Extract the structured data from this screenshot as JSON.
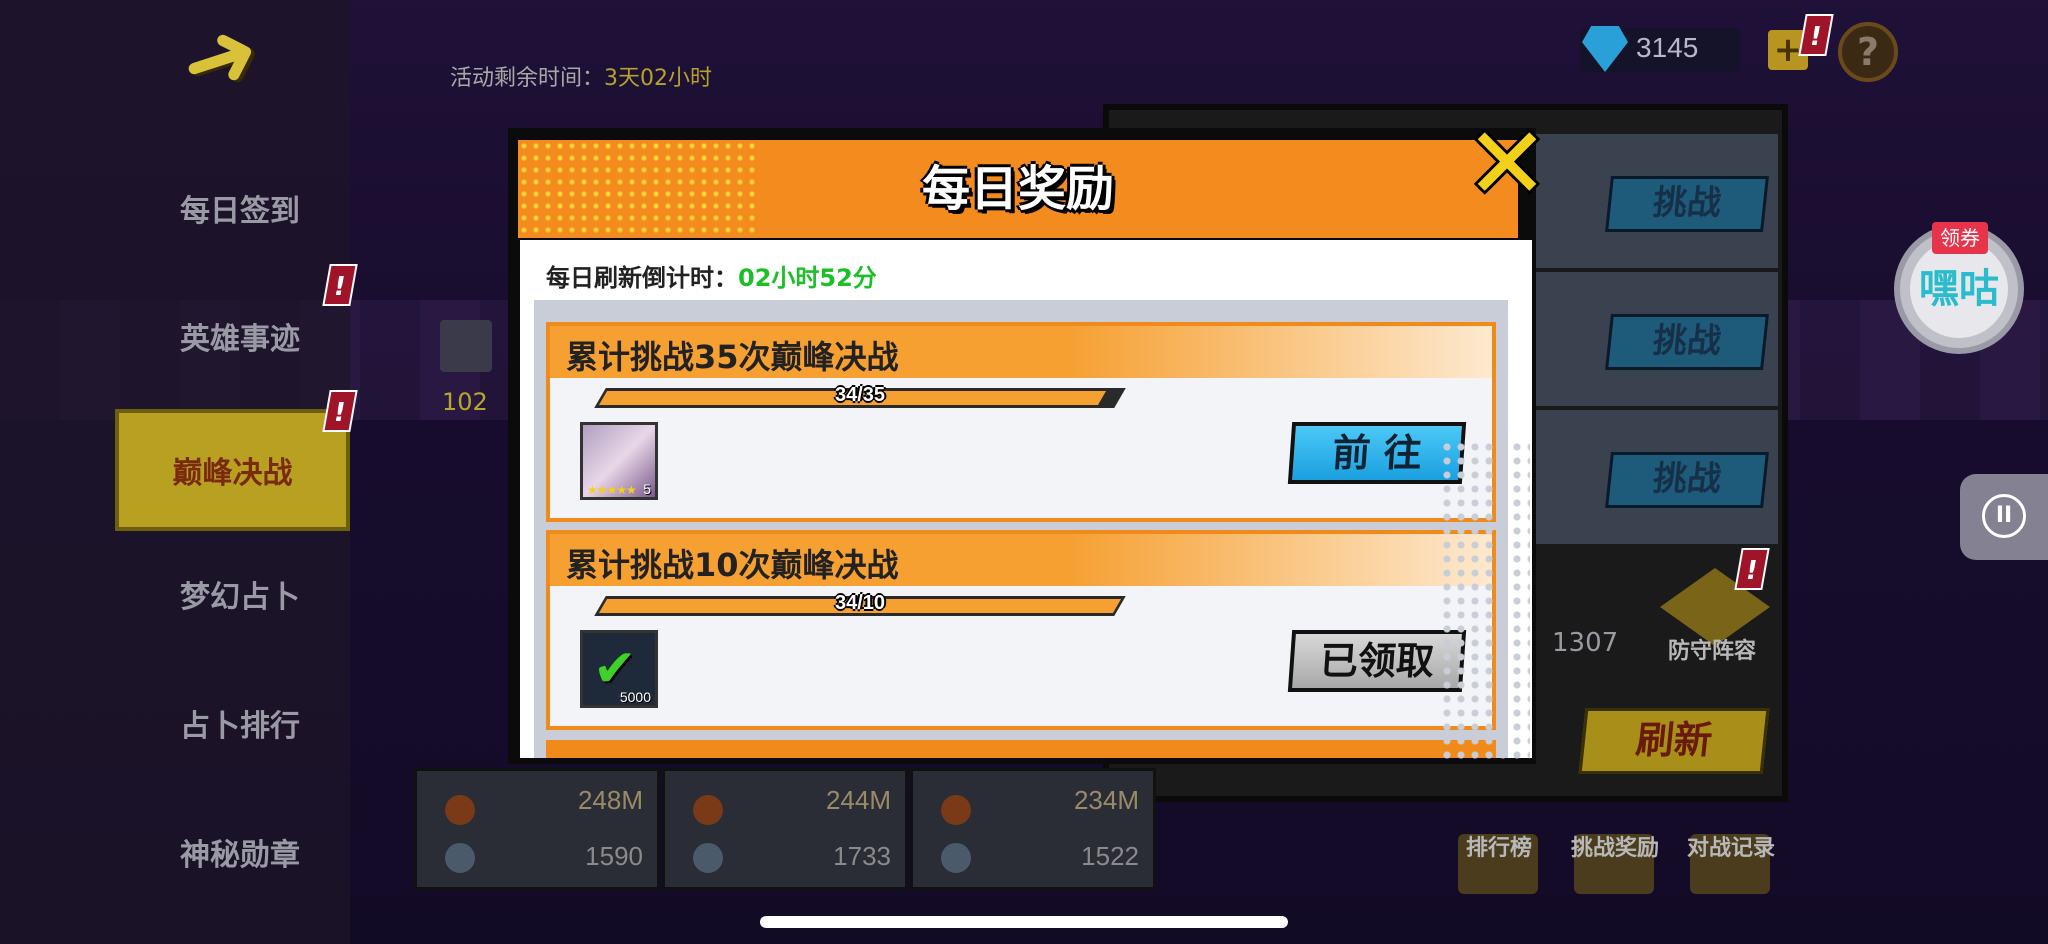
{
  "top": {
    "activity_timer_label": "活动剩余时间：",
    "activity_timer_value": "3天02小时",
    "gem_count": "3145",
    "plus_label": "+",
    "help_label": "?"
  },
  "sidebar": {
    "items": [
      {
        "label": "每日签到"
      },
      {
        "label": "英雄事迹"
      },
      {
        "label": "巅峰决战"
      },
      {
        "label": "梦幻占卜"
      },
      {
        "label": "占卜排行"
      },
      {
        "label": "神秘勋章"
      }
    ],
    "badge": "!"
  },
  "arena": {
    "level": "102",
    "stats": [
      {
        "power": "248M",
        "score": "1590"
      },
      {
        "power": "244M",
        "score": "1733"
      },
      {
        "power": "234M",
        "score": "1522"
      }
    ],
    "challenge_label": "挑战",
    "refresh_label": "刷新",
    "defense_label": "防守阵容",
    "defense_power": "1307"
  },
  "bottom_nav": [
    {
      "label": "排行榜"
    },
    {
      "label": "挑战奖励"
    },
    {
      "label": "对战记录"
    }
  ],
  "modal": {
    "title": "每日奖励",
    "close_label": "✕",
    "countdown_label": "每日刷新倒计时：",
    "countdown_value": "02小时52分",
    "tasks": [
      {
        "title": "累计挑战35次巅峰决战",
        "progress_text": "34/35",
        "progress": 0.971,
        "reward_qty": "5",
        "button": "前 往",
        "state": "go"
      },
      {
        "title": "累计挑战10次巅峰决战",
        "progress_text": "34/10",
        "progress": 1.0,
        "reward_qty": "5000",
        "button": "已领取",
        "state": "claimed"
      }
    ]
  },
  "widgets": {
    "coupon_tag": "领券",
    "coupon_name": "嘿咕",
    "pause_label": "II"
  },
  "colors": {
    "modal_header": "#f38b1e",
    "countdown_green": "#1cbf27",
    "close_yellow": "#f3d01a",
    "button_blue": "#1aa0e0"
  }
}
